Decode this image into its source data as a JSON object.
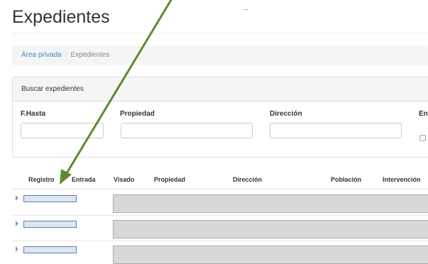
{
  "page": {
    "title": "Expedientes"
  },
  "breadcrumb": {
    "home": "Área privada",
    "separator": "/",
    "current": "Expedientes"
  },
  "search_panel": {
    "heading": "Buscar expedientes",
    "fields": [
      {
        "label": "F.Hasta",
        "value": ""
      },
      {
        "label": "Propiedad",
        "value": ""
      },
      {
        "label": "Dirección",
        "value": ""
      },
      {
        "label": "En",
        "value": ""
      }
    ]
  },
  "table": {
    "columns": [
      "Registro",
      "Entrada",
      "Visado",
      "Propiedad",
      "Dirección",
      "Población",
      "Intervención"
    ],
    "rows": [
      {
        "registro": "",
        "expanded": false
      },
      {
        "registro": "",
        "expanded": false
      },
      {
        "registro": "",
        "expanded": false
      }
    ]
  },
  "annotation": {
    "arrow_color": "#5e8a2f"
  },
  "colors": {
    "link": "#3a87c8",
    "breadcrumb_bg": "#f5f5f5",
    "panel_border": "#dddddd"
  }
}
